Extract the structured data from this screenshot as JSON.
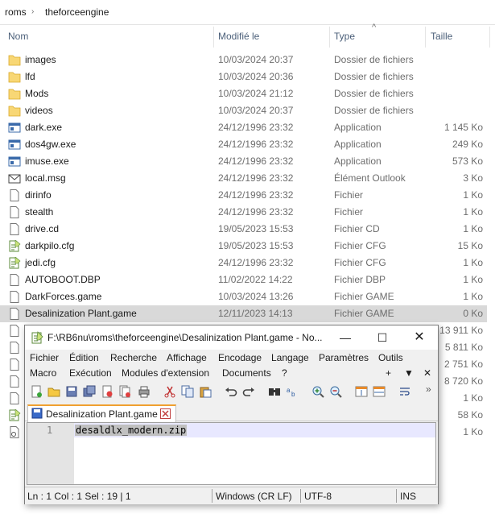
{
  "breadcrumb": {
    "items": [
      "roms",
      "theforceengine"
    ]
  },
  "columns": {
    "name": "Nom",
    "date": "Modifié le",
    "type": "Type",
    "size": "Taille"
  },
  "files": [
    {
      "name": "images",
      "date": "10/03/2024 20:37",
      "type": "Dossier de fichiers",
      "size": "",
      "icon": "folder-icon"
    },
    {
      "name": "lfd",
      "date": "10/03/2024 20:36",
      "type": "Dossier de fichiers",
      "size": "",
      "icon": "folder-icon"
    },
    {
      "name": "Mods",
      "date": "10/03/2024 21:12",
      "type": "Dossier de fichiers",
      "size": "",
      "icon": "folder-icon"
    },
    {
      "name": "videos",
      "date": "10/03/2024 20:37",
      "type": "Dossier de fichiers",
      "size": "",
      "icon": "folder-icon"
    },
    {
      "name": "dark.exe",
      "date": "24/12/1996 23:32",
      "type": "Application",
      "size": "1 145 Ko",
      "icon": "application-icon"
    },
    {
      "name": "dos4gw.exe",
      "date": "24/12/1996 23:32",
      "type": "Application",
      "size": "249 Ko",
      "icon": "application-icon"
    },
    {
      "name": "imuse.exe",
      "date": "24/12/1996 23:32",
      "type": "Application",
      "size": "573 Ko",
      "icon": "application-icon"
    },
    {
      "name": "local.msg",
      "date": "24/12/1996 23:32",
      "type": "Élément Outlook",
      "size": "3 Ko",
      "icon": "envelope-icon"
    },
    {
      "name": "dirinfo",
      "date": "24/12/1996 23:32",
      "type": "Fichier",
      "size": "1 Ko",
      "icon": "file-icon"
    },
    {
      "name": "stealth",
      "date": "24/12/1996 23:32",
      "type": "Fichier",
      "size": "1 Ko",
      "icon": "file-icon"
    },
    {
      "name": "drive.cd",
      "date": "19/05/2023 15:53",
      "type": "Fichier CD",
      "size": "1 Ko",
      "icon": "file-icon"
    },
    {
      "name": "darkpilo.cfg",
      "date": "19/05/2023 15:53",
      "type": "Fichier CFG",
      "size": "15 Ko",
      "icon": "notepad-file-icon"
    },
    {
      "name": "jedi.cfg",
      "date": "24/12/1996 23:32",
      "type": "Fichier CFG",
      "size": "1 Ko",
      "icon": "notepad-file-icon"
    },
    {
      "name": "AUTOBOOT.DBP",
      "date": "11/02/2022 14:22",
      "type": "Fichier DBP",
      "size": "1 Ko",
      "icon": "file-icon"
    },
    {
      "name": "DarkForces.game",
      "date": "10/03/2024 13:26",
      "type": "Fichier GAME",
      "size": "1 Ko",
      "icon": "file-icon"
    },
    {
      "name": "Desalinization Plant.game",
      "date": "12/11/2023 14:13",
      "type": "Fichier GAME",
      "size": "0 Ko",
      "icon": "file-icon",
      "selected": true
    },
    {
      "name": "",
      "date": "",
      "type": "",
      "size": "13 911 Ko",
      "icon": "file-icon"
    },
    {
      "name": "",
      "date": "",
      "type": "",
      "size": "5 811 Ko",
      "icon": "file-icon"
    },
    {
      "name": "",
      "date": "",
      "type": "",
      "size": "2 751 Ko",
      "icon": "file-icon"
    },
    {
      "name": "",
      "date": "",
      "type": "",
      "size": "8 720 Ko",
      "icon": "file-icon"
    },
    {
      "name": "",
      "date": "",
      "type": "",
      "size": "1 Ko",
      "icon": "file-icon"
    },
    {
      "name": "",
      "date": "",
      "type": "",
      "size": "58 Ko",
      "icon": "notepad-file-icon"
    },
    {
      "name": "",
      "date": "",
      "type": "",
      "size": "1 Ko",
      "icon": "settings-file-icon"
    }
  ],
  "notepad": {
    "title": "F:\\RB6nu\\roms\\theforceengine\\Desalinization Plant.game - No...",
    "menu1": [
      "Fichier",
      "Édition",
      "Recherche",
      "Affichage",
      "Encodage",
      "Langage",
      "Paramètres",
      "Outils"
    ],
    "menu1_right": [
      "+",
      "▼",
      "✕"
    ],
    "menu2": [
      "Macro",
      "Exécution",
      "Modules d'extension",
      "Documents",
      "?"
    ],
    "tab_label": "Desalinization Plant.game",
    "line_number": "1",
    "content": "desaldlx_modern.zip",
    "status": {
      "pos": "Ln : 1    Col : 1    Sel : 19 | 1",
      "eol": "Windows (CR LF)",
      "encoding": "UTF-8",
      "mode": "INS"
    }
  }
}
